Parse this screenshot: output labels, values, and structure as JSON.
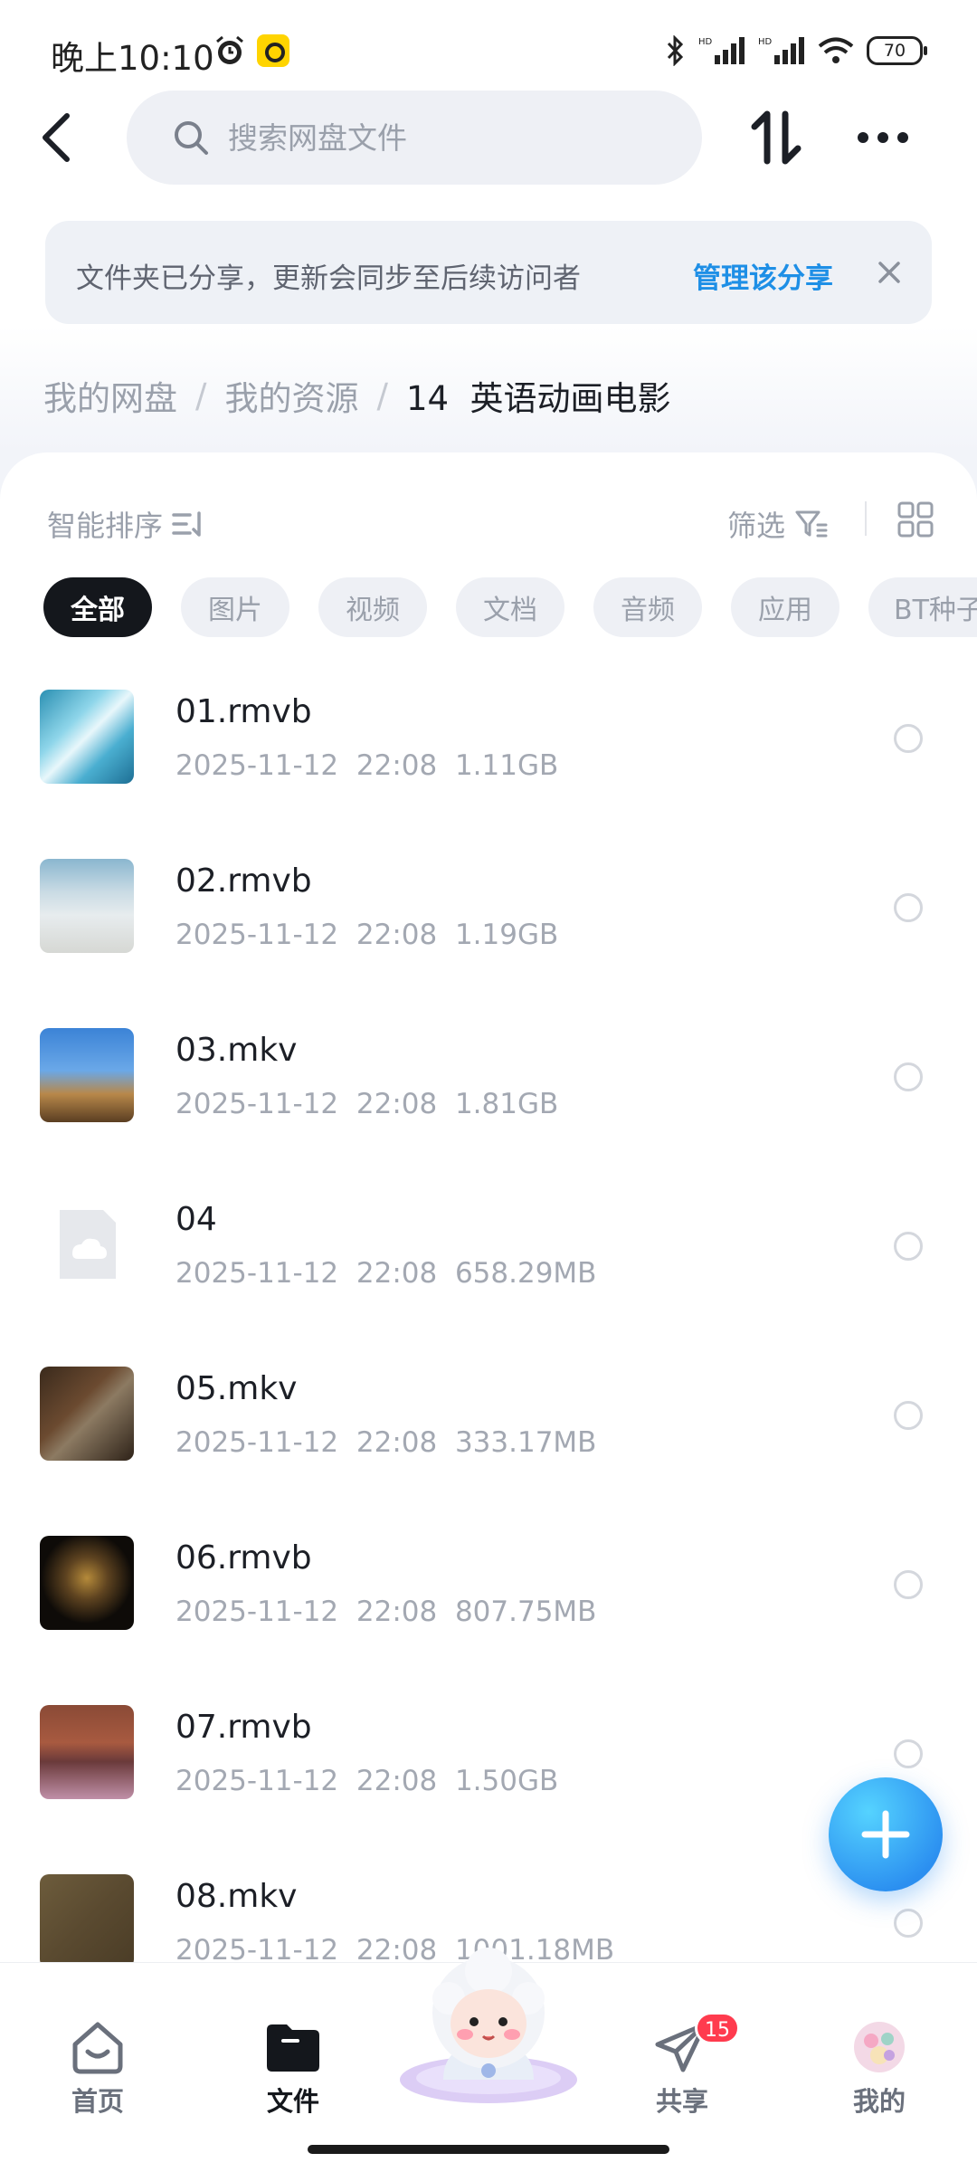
{
  "status_bar": {
    "time": "晚上10:10",
    "battery": "70"
  },
  "search": {
    "placeholder": "搜索网盘文件"
  },
  "banner": {
    "text": "文件夹已分享，更新会同步至后续访问者",
    "link": "管理该分享"
  },
  "breadcrumb": {
    "items": [
      "我的网盘",
      "我的资源",
      "14  英语动画电影"
    ]
  },
  "toolbar": {
    "sort_label": "智能排序",
    "filter_label": "筛选"
  },
  "chips": [
    "全部",
    "图片",
    "视频",
    "文档",
    "音频",
    "应用",
    "BT种子"
  ],
  "files": [
    {
      "name": "01.rmvb",
      "date": "2025-11-12",
      "time": "22:08",
      "size": "1.11GB"
    },
    {
      "name": "02.rmvb",
      "date": "2025-11-12",
      "time": "22:08",
      "size": "1.19GB"
    },
    {
      "name": "03.mkv",
      "date": "2025-11-12",
      "time": "22:08",
      "size": "1.81GB"
    },
    {
      "name": "04",
      "date": "2025-11-12",
      "time": "22:08",
      "size": "658.29MB"
    },
    {
      "name": "05.mkv",
      "date": "2025-11-12",
      "time": "22:08",
      "size": "333.17MB"
    },
    {
      "name": "06.rmvb",
      "date": "2025-11-12",
      "time": "22:08",
      "size": "807.75MB"
    },
    {
      "name": "07.rmvb",
      "date": "2025-11-12",
      "time": "22:08",
      "size": "1.50GB"
    },
    {
      "name": "08.mkv",
      "date": "2025-11-12",
      "time": "22:08",
      "size": "1001.18MB"
    }
  ],
  "tabs": [
    {
      "label": "首页"
    },
    {
      "label": "文件"
    },
    {
      "label": "共享",
      "badge": "15"
    },
    {
      "label": "我的"
    }
  ],
  "colors": {
    "accent": "#1e8fe6",
    "badge": "#ff3b4e",
    "active_chip": "#14171c"
  }
}
